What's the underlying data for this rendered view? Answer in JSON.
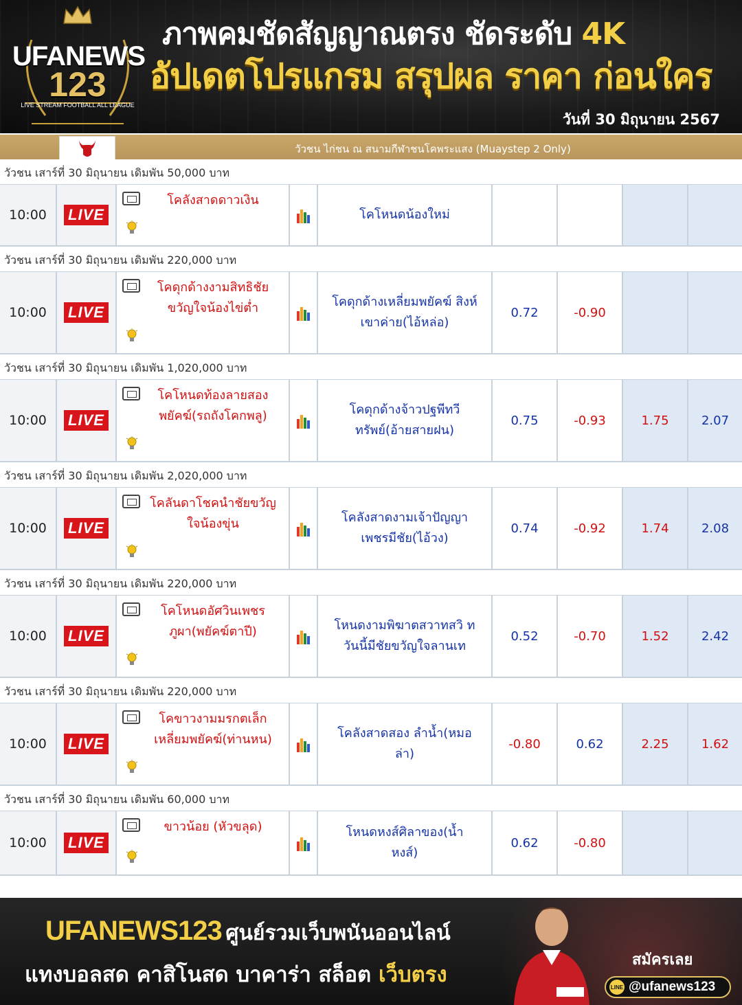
{
  "header": {
    "logo_brand_top": "UFANEWS",
    "logo_brand_num": "123",
    "logo_tagline": "LIVE STREAM FOOTBALL ALL LEAGUE",
    "title_line1": "ภาพคมชัดสัญญาณตรง ชัดระดับ",
    "title_line1_highlight": "4K",
    "title_line2": "อัปเดตโปรแกรม สรุปผล ราคา ก่อนใคร",
    "date": "วันที่ 30 มิถุนายน 2567"
  },
  "league": {
    "title": "วัวชน ไก่ชน ณ สนามกีฬาชนโคพระแสง (Muaystep 2 Only)"
  },
  "labels": {
    "live": "LIVE"
  },
  "matches": [
    {
      "section": "วัวชน เสาร์ที่ 30 มิถุนายน เดิมพัน 50,000 บาท",
      "time": "10:00",
      "home": "โคลังสาดดาวเงิน",
      "away": "โคโหนดน้องใหม่",
      "odds": [
        "",
        "",
        "",
        ""
      ]
    },
    {
      "section": "วัวชน เสาร์ที่ 30 มิถุนายน เดิมพัน 220,000 บาท",
      "time": "10:00",
      "home": "โคดุกด้างงามสิทธิชัย ขวัญใจน้องไข่ต่ำ",
      "away": "โคดุกด้างเหลี่ยมพยัคฆ์ สิงห์เขาค่าย(ไอ้หล่อ)",
      "odds": [
        "0.72",
        "-0.90",
        "",
        ""
      ]
    },
    {
      "section": "วัวชน เสาร์ที่ 30 มิถุนายน เดิมพัน 1,020,000 บาท",
      "time": "10:00",
      "home": "โคโหนดท้องลายสอง พยัคฆ์(รถถังโคกพลู)",
      "away": "โคดุกด้างจ้าวปฐพีทวี ทรัพย์(อ้ายสายฝน)",
      "odds": [
        "0.75",
        "-0.93",
        "1.75",
        "2.07"
      ]
    },
    {
      "section": "วัวชน เสาร์ที่ 30 มิถุนายน เดิมพัน 2,020,000 บาท",
      "time": "10:00",
      "home": "โคลันดาโชคนำชัยขวัญ ใจน้องขุ่น",
      "away": "โคลังสาดงามเจ้าปัญญา เพชรมีชัย(ไอ้วง)",
      "odds": [
        "0.74",
        "-0.92",
        "1.74",
        "2.08"
      ]
    },
    {
      "section": "วัวชน เสาร์ที่ 30 มิถุนายน เดิมพัน 220,000 บาท",
      "time": "10:00",
      "home": "โคโหนดอัศวินเพชร ภูผา(พยัคฆ์ตาปี)",
      "away": "โหนดงามพิฆาตสวาทสวิ ทวันนี้มีชัยขวัญใจลานเท",
      "odds": [
        "0.52",
        "-0.70",
        "1.52",
        "2.42"
      ]
    },
    {
      "section": "วัวชน เสาร์ที่ 30 มิถุนายน เดิมพัน 220,000 บาท",
      "time": "10:00",
      "home": "โคขาวงามมรกตเล็ก เหลี่ยมพยัคฆ์(ท่านหน)",
      "away": "โคลังสาดสอง ลำน้ำ(หมอล่า)",
      "odds": [
        "-0.80",
        "0.62",
        "2.25",
        "1.62"
      ]
    },
    {
      "section": "วัวชน เสาร์ที่ 30 มิถุนายน เดิมพัน 60,000 บาท",
      "time": "10:00",
      "home": "ขาวน้อย (หัวขลุด)",
      "away": "โหนดหงส์ศิลาของ(น้ำ หงส์)",
      "odds": [
        "0.62",
        "-0.80",
        "",
        ""
      ]
    }
  ],
  "footer": {
    "brand": "UFANEWS123",
    "line1": "ศูนย์รวมเว็บพนันออนไลน์",
    "line2": "แทงบอลสด คาสิโนสด บาคาร่า สล็อต",
    "line2_highlight": "เว็บตรง",
    "signup": "สมัครเลย",
    "line_icon": "LINE",
    "line_id": "@ufanews123"
  },
  "colors": {
    "odds_positive": "#1533a6",
    "odds_negative": "#d01010",
    "gold": "#f3cf47",
    "live_red": "#d8151b"
  },
  "icons": {
    "tv": "tv-icon",
    "bulb": "lightbulb-icon",
    "stats": "bar-chart-icon",
    "team_logo": "bull-head-icon"
  }
}
